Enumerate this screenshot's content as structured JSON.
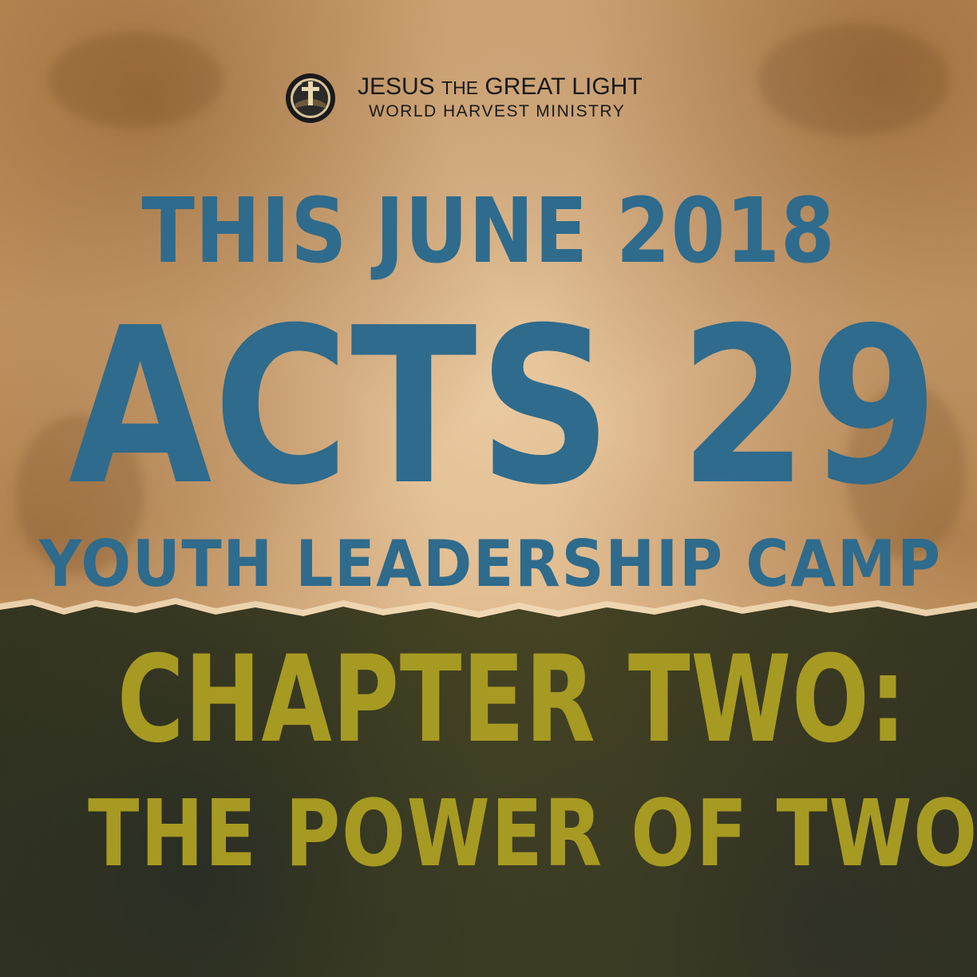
{
  "logo": {
    "emblem_icon": "cross-globe-emblem-icon",
    "name_part1": "JESUS",
    "name_part2": "THE",
    "name_part3": "GREAT LIGHT",
    "subtitle": "WORLD HARVEST MINISTRY"
  },
  "headline": {
    "date_line": "THIS JUNE 2018",
    "title": "ACTS 29",
    "subtitle": "YOUTH LEADERSHIP CAMP"
  },
  "chapter": {
    "line1": "CHAPTER TWO:",
    "line2": "THE POWER OF TWO"
  },
  "colors": {
    "paper": "#dcb487",
    "blue_text": "#2f6b8c",
    "yellow_text": "#a79a22",
    "dark_band": "#413f1e"
  }
}
